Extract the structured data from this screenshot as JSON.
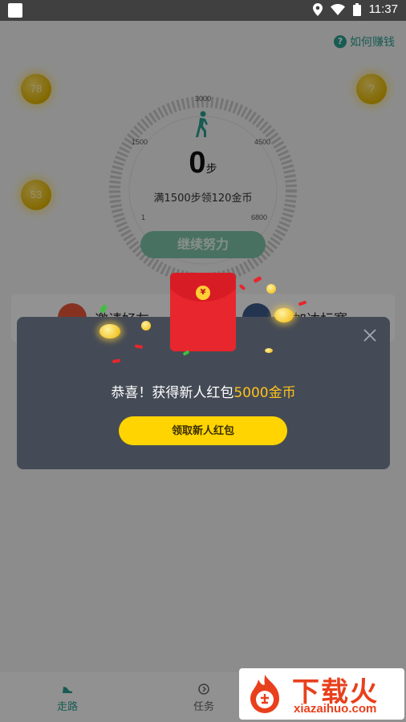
{
  "status_bar": {
    "time": "11:37"
  },
  "header": {
    "help_label": "如何赚钱"
  },
  "coins": [
    {
      "label": "78"
    },
    {
      "label": "?"
    },
    {
      "label": "53"
    }
  ],
  "dial": {
    "tick_labels": [
      "3000",
      "1500",
      "4500",
      "1",
      "6800"
    ],
    "steps_value": "0",
    "steps_unit": "步",
    "goal_text": "满1500步领120金币"
  },
  "continue_label": "继续努力",
  "cards": [
    {
      "label": "邀请好友"
    },
    {
      "label": "参加达标赛"
    }
  ],
  "bottom_nav": [
    {
      "label": "走路",
      "active": true
    },
    {
      "label": "任务",
      "active": false
    }
  ],
  "dialog": {
    "message_prefix": "恭喜！获得新人红包",
    "message_highlight": "5000金币",
    "claim_label": "领取新人红包",
    "envelope_seal": "¥"
  },
  "watermark": {
    "title": "下载火",
    "subtitle": "xiazaihuo.com"
  },
  "colors": {
    "accent": "#2a9d8f",
    "highlight": "#ffc21a",
    "button": "#ffd400",
    "envelope": "#e8262d"
  }
}
